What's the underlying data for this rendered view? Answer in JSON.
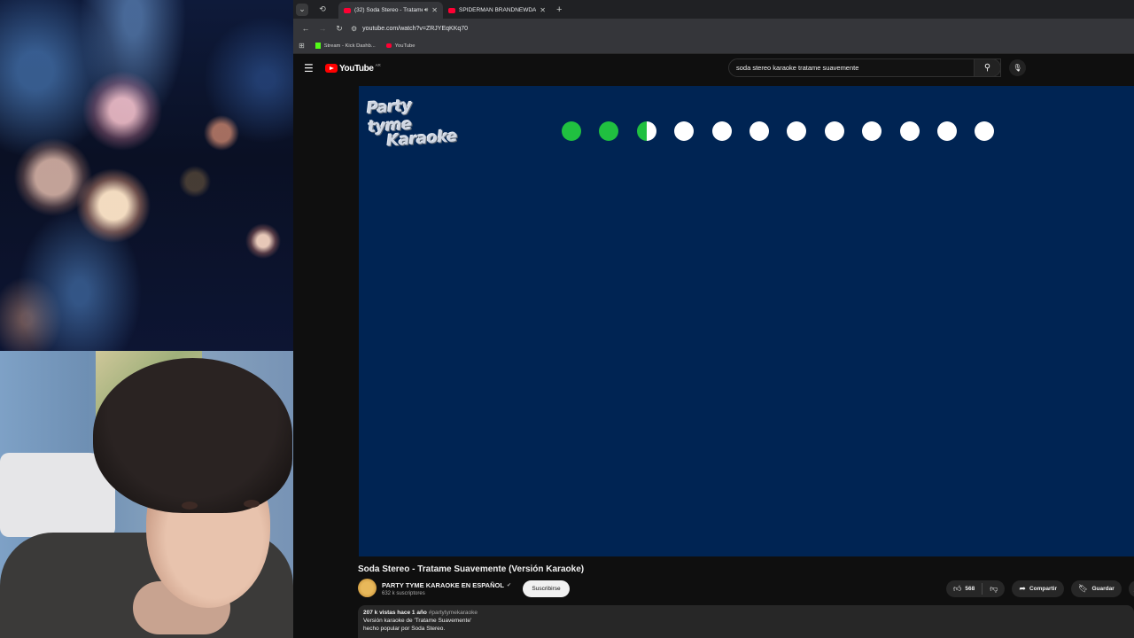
{
  "browser": {
    "tabs": [
      {
        "title": "(32) Soda Stereo - Tratame",
        "active": true,
        "audio": true
      },
      {
        "title": "SPIDERMAN BRANDNEWDAY |",
        "active": false,
        "audio": false
      }
    ],
    "url": "youtube.com/watch?v=ZRJYEqKKq70",
    "bookmarks": [
      {
        "label": "Stream - Kick Dashb...",
        "icon": "kick-icon"
      },
      {
        "label": "YouTube",
        "icon": "youtube-icon"
      }
    ]
  },
  "youtube": {
    "logo_text": "YouTube",
    "country_code": "AR",
    "search_query": "soda stereo karaoke tratame suavemente"
  },
  "player": {
    "background_color": "#002453",
    "logo_line1": "Party tyme",
    "logo_line2": "Karaoke",
    "countdown": {
      "total": 12,
      "completed": 2.5,
      "on_color": "#20c040",
      "off_color": "#ffffff"
    }
  },
  "video": {
    "title": "Soda Stereo - Tratame Suavemente (Versión Karaoke)",
    "channel_name": "PARTY TYME KARAOKE EN ESPAÑOL",
    "subscribers": "632 k suscriptores",
    "subscribe_label": "Suscribirse",
    "likes": "568",
    "share_label": "Compartir",
    "save_label": "Guardar",
    "views_date": "207 k vistas  hace 1 año",
    "hashtag": "#partytymekaraoke",
    "description_line1": "Versión karaoke de 'Tratame Suavemente'",
    "description_line2": "hecho popular por Soda Stereo."
  }
}
